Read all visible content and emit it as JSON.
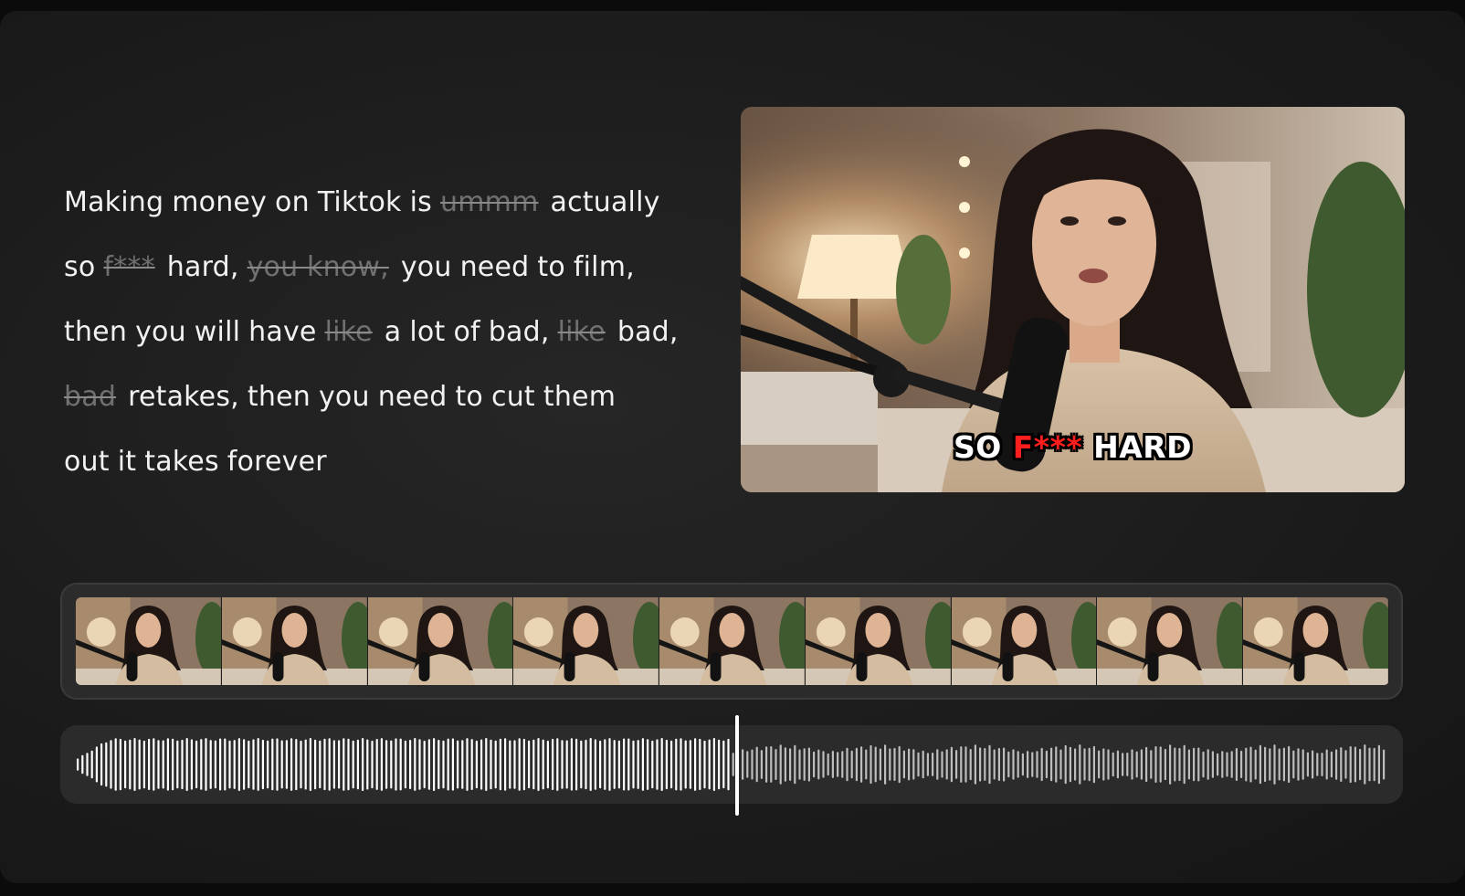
{
  "transcript": {
    "lines": [
      [
        {
          "text": "Making",
          "cut": false
        },
        {
          "text": "money",
          "cut": false
        },
        {
          "text": "on",
          "cut": false
        },
        {
          "text": "Tiktok",
          "cut": false
        },
        {
          "text": "is",
          "cut": false
        },
        {
          "text": "ummm",
          "cut": true
        },
        {
          "text": "actually",
          "cut": false
        }
      ],
      [
        {
          "text": "so",
          "cut": false
        },
        {
          "text": "f***",
          "cut": true
        },
        {
          "text": "hard,",
          "cut": false
        },
        {
          "text": "you know,",
          "cut": true
        },
        {
          "text": "you",
          "cut": false
        },
        {
          "text": "need",
          "cut": false
        },
        {
          "text": "to",
          "cut": false
        },
        {
          "text": "film,",
          "cut": false
        }
      ],
      [
        {
          "text": "then",
          "cut": false
        },
        {
          "text": "you",
          "cut": false
        },
        {
          "text": "will",
          "cut": false
        },
        {
          "text": "have",
          "cut": false
        },
        {
          "text": "like",
          "cut": true
        },
        {
          "text": "a",
          "cut": false
        },
        {
          "text": "lot",
          "cut": false
        },
        {
          "text": "of",
          "cut": false
        },
        {
          "text": "bad,",
          "cut": false
        },
        {
          "text": "like",
          "cut": true
        },
        {
          "text": "bad,",
          "cut": false
        }
      ],
      [
        {
          "text": "bad",
          "cut": true
        },
        {
          "text": "retakes,",
          "cut": false
        },
        {
          "text": "then",
          "cut": false
        },
        {
          "text": "you",
          "cut": false
        },
        {
          "text": "need",
          "cut": false
        },
        {
          "text": "to",
          "cut": false
        },
        {
          "text": "cut",
          "cut": false
        },
        {
          "text": "them",
          "cut": false
        }
      ],
      [
        {
          "text": "out",
          "cut": false
        },
        {
          "text": "it",
          "cut": false
        },
        {
          "text": "takes",
          "cut": false
        },
        {
          "text": "forever",
          "cut": false
        }
      ]
    ]
  },
  "preview": {
    "caption_before": "SO ",
    "caption_highlight": "F***",
    "caption_after": " HARD",
    "highlight_color": "#ff1e1e"
  },
  "filmstrip": {
    "frame_count": 9
  },
  "waveform": {
    "playhead_progress": 0.5
  },
  "colors": {
    "background": "#1c1c1c",
    "text": "#f2f2f2",
    "cut_text": "#707070",
    "track": "#2b2b2b"
  }
}
